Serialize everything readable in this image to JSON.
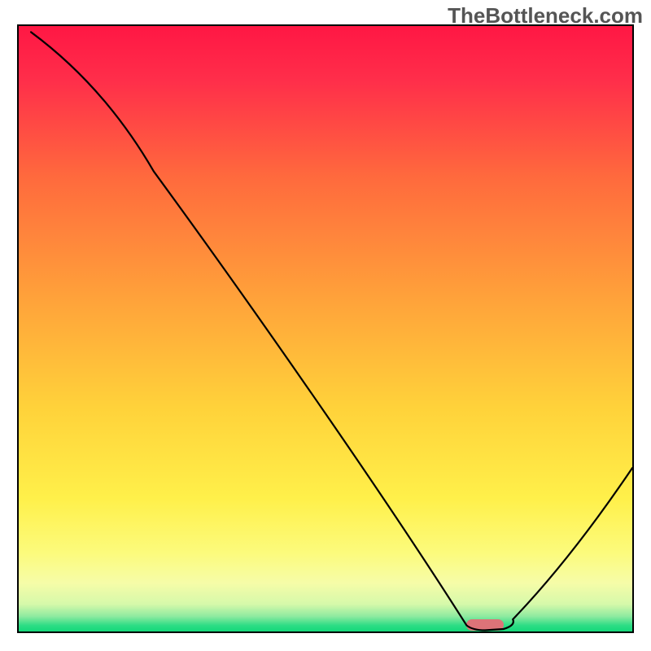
{
  "watermark": "TheBottleneck.com",
  "chart_data": {
    "type": "line",
    "title": "",
    "xlabel": "",
    "ylabel": "",
    "ylim": [
      0,
      100
    ],
    "xlim": [
      0,
      100
    ],
    "series": [
      {
        "name": "bottleneck-curve",
        "x": [
          2,
          22,
          73,
          80,
          100
        ],
        "y": [
          99,
          76,
          1,
          1,
          27
        ]
      }
    ],
    "annotations": [
      {
        "name": "optimal-range-marker",
        "x_center": 76,
        "y": 0.8,
        "color": "#dd7378"
      }
    ],
    "gradient_stops": [
      {
        "offset": 0.0,
        "color": "#ff1744"
      },
      {
        "offset": 0.09,
        "color": "#ff2e4a"
      },
      {
        "offset": 0.25,
        "color": "#ff6a3d"
      },
      {
        "offset": 0.45,
        "color": "#ffa23a"
      },
      {
        "offset": 0.63,
        "color": "#ffd23a"
      },
      {
        "offset": 0.78,
        "color": "#fff04a"
      },
      {
        "offset": 0.87,
        "color": "#fcfb7c"
      },
      {
        "offset": 0.92,
        "color": "#f6fca8"
      },
      {
        "offset": 0.955,
        "color": "#d6f9aa"
      },
      {
        "offset": 0.975,
        "color": "#8eeaa0"
      },
      {
        "offset": 0.99,
        "color": "#2ddd85"
      },
      {
        "offset": 1.0,
        "color": "#14d87a"
      }
    ]
  }
}
